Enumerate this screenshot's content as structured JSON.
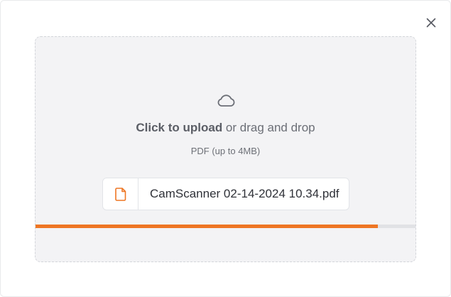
{
  "upload": {
    "main_bold": "Click to upload",
    "main_rest": " or drag and drop",
    "hint": "PDF (up to 4MB)"
  },
  "file": {
    "name": "CamScanner 02-14-2024 10.34.pdf"
  },
  "progress": {
    "fraction": 0.9
  },
  "icons": {
    "close": "close-icon",
    "cloud": "cloud-icon",
    "file": "file-icon"
  },
  "colors": {
    "accent": "#ee7623",
    "dropzone_bg": "#f3f3f5"
  }
}
